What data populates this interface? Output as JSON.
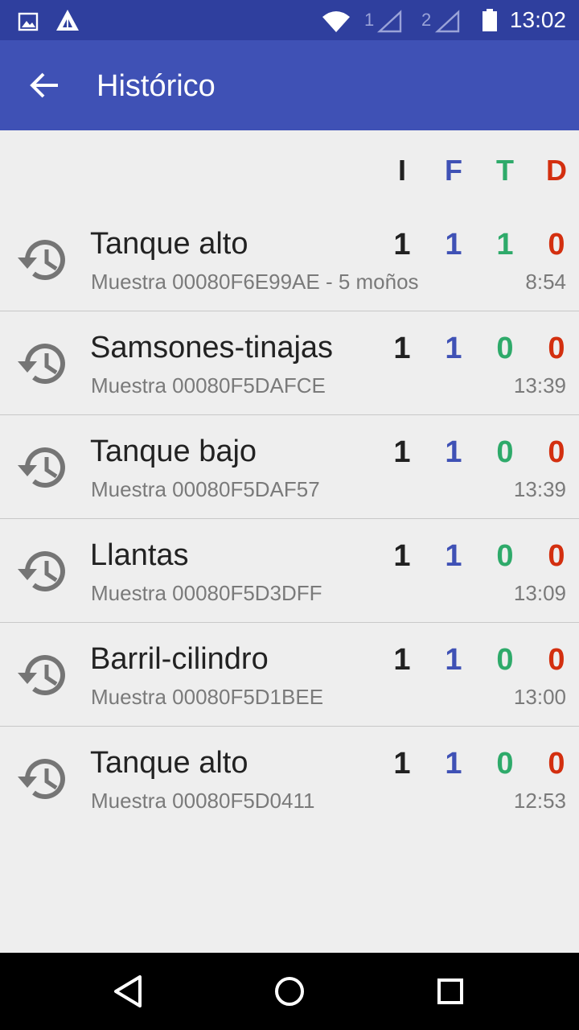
{
  "status_bar": {
    "time": "13:02",
    "sim1": "1",
    "sim2": "2",
    "icons": [
      "image-icon",
      "app-triangle-icon",
      "wifi-icon",
      "signal-icon",
      "signal-icon",
      "battery-icon"
    ]
  },
  "toolbar": {
    "title": "Histórico",
    "back_icon": "arrow-back-icon"
  },
  "columns": [
    {
      "label": "I",
      "color": "#212121"
    },
    {
      "label": "F",
      "color": "#3f51b5"
    },
    {
      "label": "T",
      "color": "#2eaa6a"
    },
    {
      "label": "D",
      "color": "#d32f0f"
    }
  ],
  "items": [
    {
      "name": "Tanque alto",
      "subtitle": "Muestra 00080F6E99AE - 5 moños",
      "time": "8:54",
      "I": "1",
      "F": "1",
      "T": "1",
      "D": "0"
    },
    {
      "name": "Samsones-tinajas",
      "subtitle": "Muestra 00080F5DAFCE",
      "time": "13:39",
      "I": "1",
      "F": "1",
      "T": "0",
      "D": "0"
    },
    {
      "name": "Tanque bajo",
      "subtitle": "Muestra 00080F5DAF57",
      "time": "13:39",
      "I": "1",
      "F": "1",
      "T": "0",
      "D": "0"
    },
    {
      "name": "Llantas",
      "subtitle": "Muestra 00080F5D3DFF",
      "time": "13:09",
      "I": "1",
      "F": "1",
      "T": "0",
      "D": "0"
    },
    {
      "name": "Barril-cilindro",
      "subtitle": "Muestra 00080F5D1BEE",
      "time": "13:00",
      "I": "1",
      "F": "1",
      "T": "0",
      "D": "0"
    },
    {
      "name": "Tanque alto",
      "subtitle": "Muestra 00080F5D0411",
      "time": "12:53",
      "I": "1",
      "F": "1",
      "T": "0",
      "D": "0"
    }
  ],
  "nav_bar": {
    "icons": [
      "back-triangle-icon",
      "home-circle-icon",
      "recents-square-icon"
    ]
  }
}
